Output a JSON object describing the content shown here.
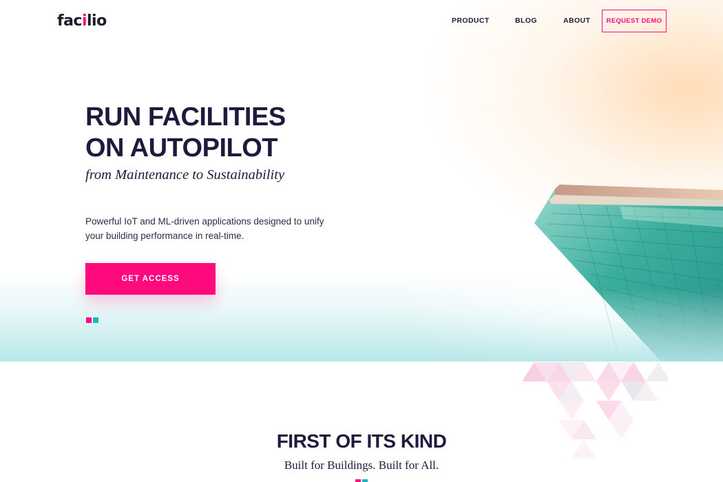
{
  "header": {
    "logo_pre": "fac",
    "logo_i": "i",
    "logo_post": "lio",
    "nav": {
      "product": "PRODUCT",
      "blog": "BLOG",
      "about": "ABOUT"
    },
    "request_demo": "REQUEST DEMO"
  },
  "hero": {
    "headline_line1": "RUN FACILITIES",
    "headline_line2": "ON AUTOPILOT",
    "subhead": "from Maintenance to Sustainability",
    "desc_line1": "Powerful IoT and ML-driven applications designed to unify",
    "desc_line2": "your building performance in real-time.",
    "cta": "GET ACCESS"
  },
  "section": {
    "title": "FIRST OF ITS KIND",
    "subtitle": "Built for Buildings. Built for All."
  },
  "colors": {
    "accent": "#ff0a7d",
    "teal": "#1cb5c1",
    "navy": "#1f1a3d"
  }
}
